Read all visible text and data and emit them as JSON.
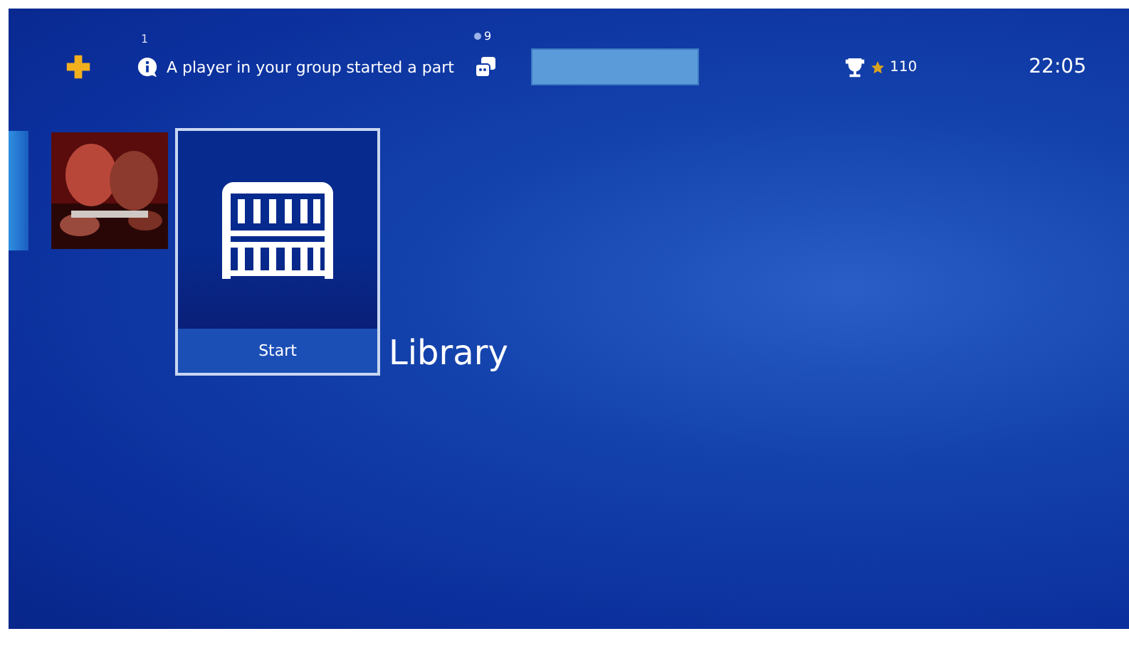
{
  "top_bar": {
    "notification": {
      "count": "1",
      "text": "A player in your group started a part"
    },
    "friends": {
      "online_count": "9"
    },
    "trophies": {
      "level": "110"
    },
    "clock": "22:05"
  },
  "tiles": [
    {
      "kind": "picture",
      "selected": false
    },
    {
      "kind": "library",
      "selected": true,
      "action": "Start",
      "title": "Library"
    }
  ]
}
